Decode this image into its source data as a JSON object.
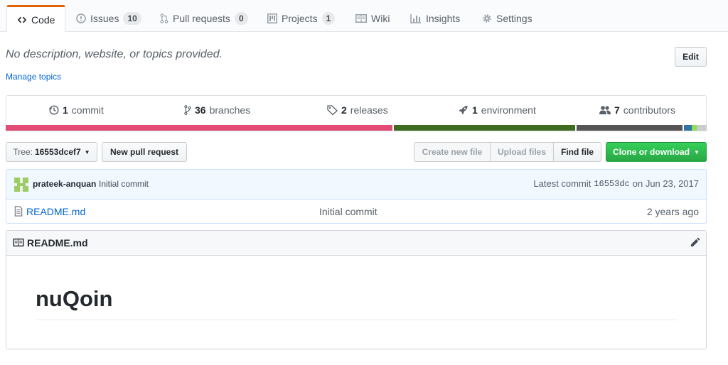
{
  "tabs": [
    {
      "label": "Code",
      "icon": "code-icon"
    },
    {
      "label": "Issues",
      "count": "10",
      "icon": "issue-icon"
    },
    {
      "label": "Pull requests",
      "count": "0",
      "icon": "pull-request-icon"
    },
    {
      "label": "Projects",
      "count": "1",
      "icon": "project-icon"
    },
    {
      "label": "Wiki",
      "icon": "book-icon"
    },
    {
      "label": "Insights",
      "icon": "graph-icon"
    },
    {
      "label": "Settings",
      "icon": "gear-icon"
    }
  ],
  "repo": {
    "description": "No description, website, or topics provided.",
    "edit_label": "Edit",
    "manage_topics": "Manage topics"
  },
  "summary": {
    "commits": {
      "count": "1",
      "label": "commit"
    },
    "branches": {
      "count": "36",
      "label": "branches"
    },
    "releases": {
      "count": "2",
      "label": "releases"
    },
    "environments": {
      "count": "1",
      "label": "environment"
    },
    "contributors": {
      "count": "7",
      "label": "contributors"
    }
  },
  "languages": [
    {
      "percent": 55.2,
      "color": "#e34c76"
    },
    {
      "percent": 0.2,
      "color": "#ffffff"
    },
    {
      "percent": 25.8,
      "color": "#3f6b21"
    },
    {
      "percent": 0.2,
      "color": "#ffffff"
    },
    {
      "percent": 15.2,
      "color": "#555555"
    },
    {
      "percent": 0.2,
      "color": "#ffffff"
    },
    {
      "percent": 1.1,
      "color": "#3572a5"
    },
    {
      "percent": 0.7,
      "color": "#89e051"
    },
    {
      "percent": 1.4,
      "color": "#cccccc"
    }
  ],
  "toolbar": {
    "tree_label": "Tree:",
    "tree_value": "16553dcef7",
    "new_pr": "New pull request",
    "create_file": "Create new file",
    "upload_files": "Upload files",
    "find_file": "Find file",
    "clone": "Clone or download"
  },
  "commit": {
    "author": "prateek-anquan",
    "message": "Initial commit",
    "latest_label": "Latest commit",
    "sha": "16553dc",
    "date": "on Jun 23, 2017"
  },
  "files": [
    {
      "name": "README.md",
      "message": "Initial commit",
      "age": "2 years ago"
    }
  ],
  "readme": {
    "filename": "README.md",
    "heading": "nuQoin"
  },
  "colors": {
    "accent_tab": "#e36209",
    "link": "#0366d6",
    "clone_button": "#28a745"
  }
}
